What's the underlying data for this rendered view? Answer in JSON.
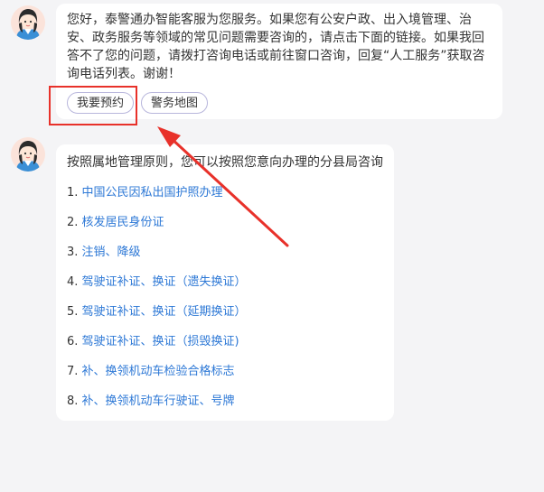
{
  "message1": {
    "text": "您好，泰警通办智能客服为您服务。如果您有公安户政、出入境管理、治安、政务服务等领域的常见问题需要咨询的，请点击下面的链接。如果我回答不了您的问题，请拨打咨询电话或前往窗口咨询，回复“人工服务”获取咨询电话列表。谢谢！",
    "buttons": [
      "我要预约",
      "警务地图"
    ]
  },
  "message2": {
    "intro": "按照属地管理原则，您可以按照您意向办理的分县局咨询",
    "items": [
      {
        "num": "1.",
        "label": "中国公民因私出国护照办理"
      },
      {
        "num": "2.",
        "label": "核发居民身份证"
      },
      {
        "num": "3.",
        "label": "注销、降级"
      },
      {
        "num": "4.",
        "label": "驾驶证补证、换证（遗失换证）"
      },
      {
        "num": "5.",
        "label": "驾驶证补证、换证（延期换证）"
      },
      {
        "num": "6.",
        "label": "驾驶证补证、换证（损毁换证)"
      },
      {
        "num": "7.",
        "label": "补、换领机动车检验合格标志"
      },
      {
        "num": "8.",
        "label": "补、换领机动车行驶证、号牌"
      }
    ]
  },
  "colors": {
    "link": "#2d78d6",
    "highlight": "#e8312a",
    "background": "#f4f4f6"
  }
}
